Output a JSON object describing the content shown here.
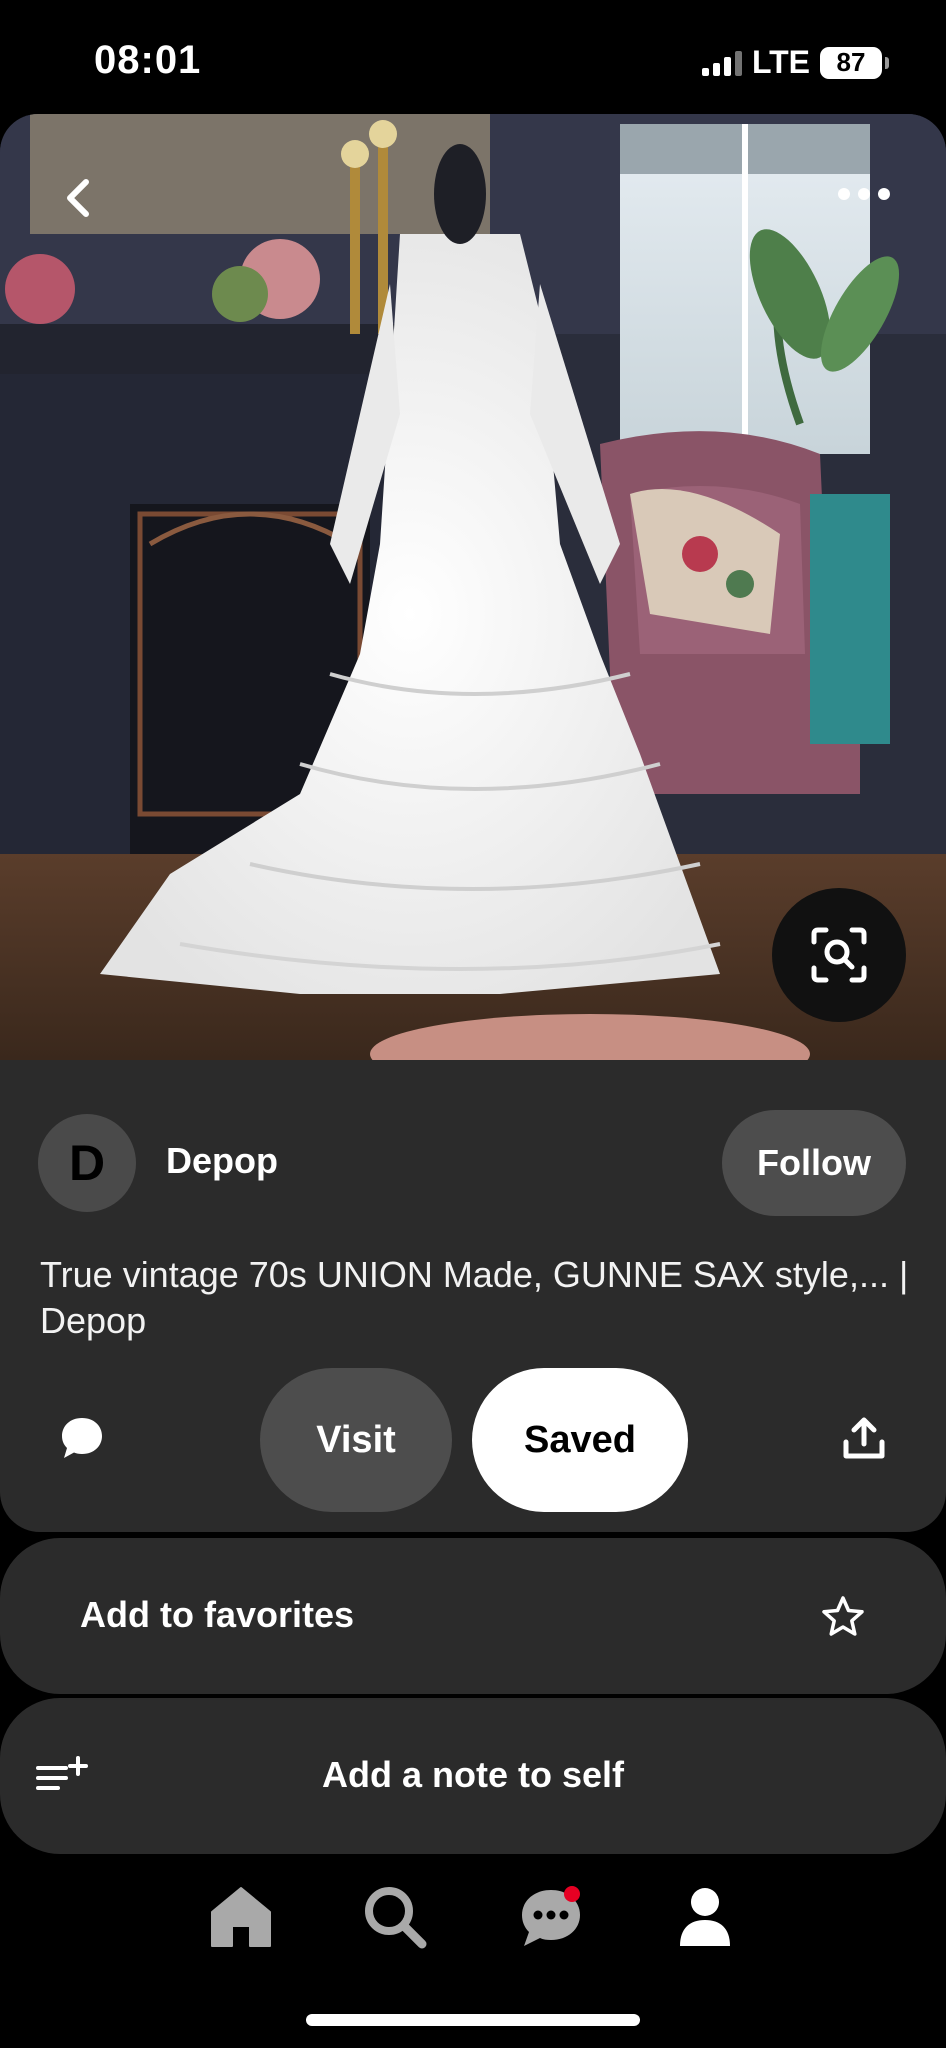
{
  "status_bar": {
    "time": "08:01",
    "network": "LTE",
    "battery": "87"
  },
  "pin": {
    "image_icons": {
      "back": "chevron-left-icon",
      "more": "more-icon",
      "visual_search": "visual-search-icon"
    },
    "creator": {
      "initial": "D",
      "name": "Depop",
      "follow_label": "Follow"
    },
    "title": "True vintage 70s UNION Made, GUNNE SAX style,... | Depop",
    "actions": {
      "visit_label": "Visit",
      "saved_label": "Saved"
    }
  },
  "options": {
    "favorites_label": "Add to favorites",
    "note_label": "Add a note to self"
  },
  "nav": {
    "items": [
      "home-icon",
      "search-icon",
      "messages-icon",
      "profile-icon"
    ],
    "messages_has_notification": true
  },
  "colors": {
    "background": "#000000",
    "card": "#2b2b2b",
    "button_secondary": "#4d4d4d",
    "notification": "#e60023"
  }
}
